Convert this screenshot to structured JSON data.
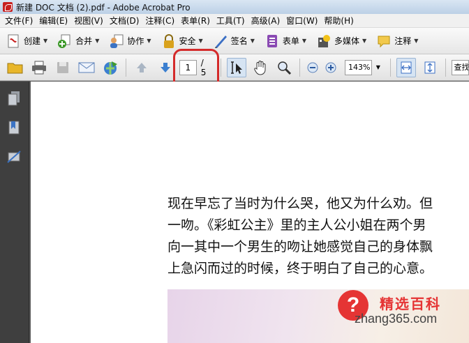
{
  "window": {
    "title": "新建 DOC 文档 (2).pdf - Adobe Acrobat Pro"
  },
  "menubar": {
    "items": [
      "文件(F)",
      "编辑(E)",
      "视图(V)",
      "文档(D)",
      "注释(C)",
      "表单(R)",
      "工具(T)",
      "高级(A)",
      "窗口(W)",
      "帮助(H)"
    ]
  },
  "toolbar_tasks": {
    "items": [
      {
        "label": "创建",
        "icon": "create-pdf-icon",
        "color": "#c8201f"
      },
      {
        "label": "合并",
        "icon": "combine-files-icon",
        "color": "#3f9a2c"
      },
      {
        "label": "协作",
        "icon": "collaborate-icon",
        "color": "#3b73c4"
      },
      {
        "label": "安全",
        "icon": "lock-icon",
        "color": "#d9a21c"
      },
      {
        "label": "签名",
        "icon": "pen-sign-icon",
        "color": "#3b6fc4"
      },
      {
        "label": "表单",
        "icon": "form-icon",
        "color": "#8a4ab3"
      },
      {
        "label": "多媒体",
        "icon": "multimedia-icon",
        "color": "#d9b01c"
      },
      {
        "label": "注释",
        "icon": "comment-icon",
        "color": "#e8b52a"
      }
    ]
  },
  "toolbar_nav": {
    "page_current": "1",
    "page_total": "/ 5",
    "zoom": "143%",
    "search_placeholder": "查找"
  },
  "document": {
    "lines": [
      "现在早忘了当时为什么哭，他又为什么劝。但",
      "一吻。《彩虹公主》里的主人公小姐在两个男",
      "向一其中一个男生的吻让她感觉自己的身体飘",
      "上急闪而过的时候，终于明白了自己的心意。"
    ]
  },
  "watermark": {
    "brand": "精选百科",
    "url": "zhang365.com",
    "symbol": "?"
  }
}
